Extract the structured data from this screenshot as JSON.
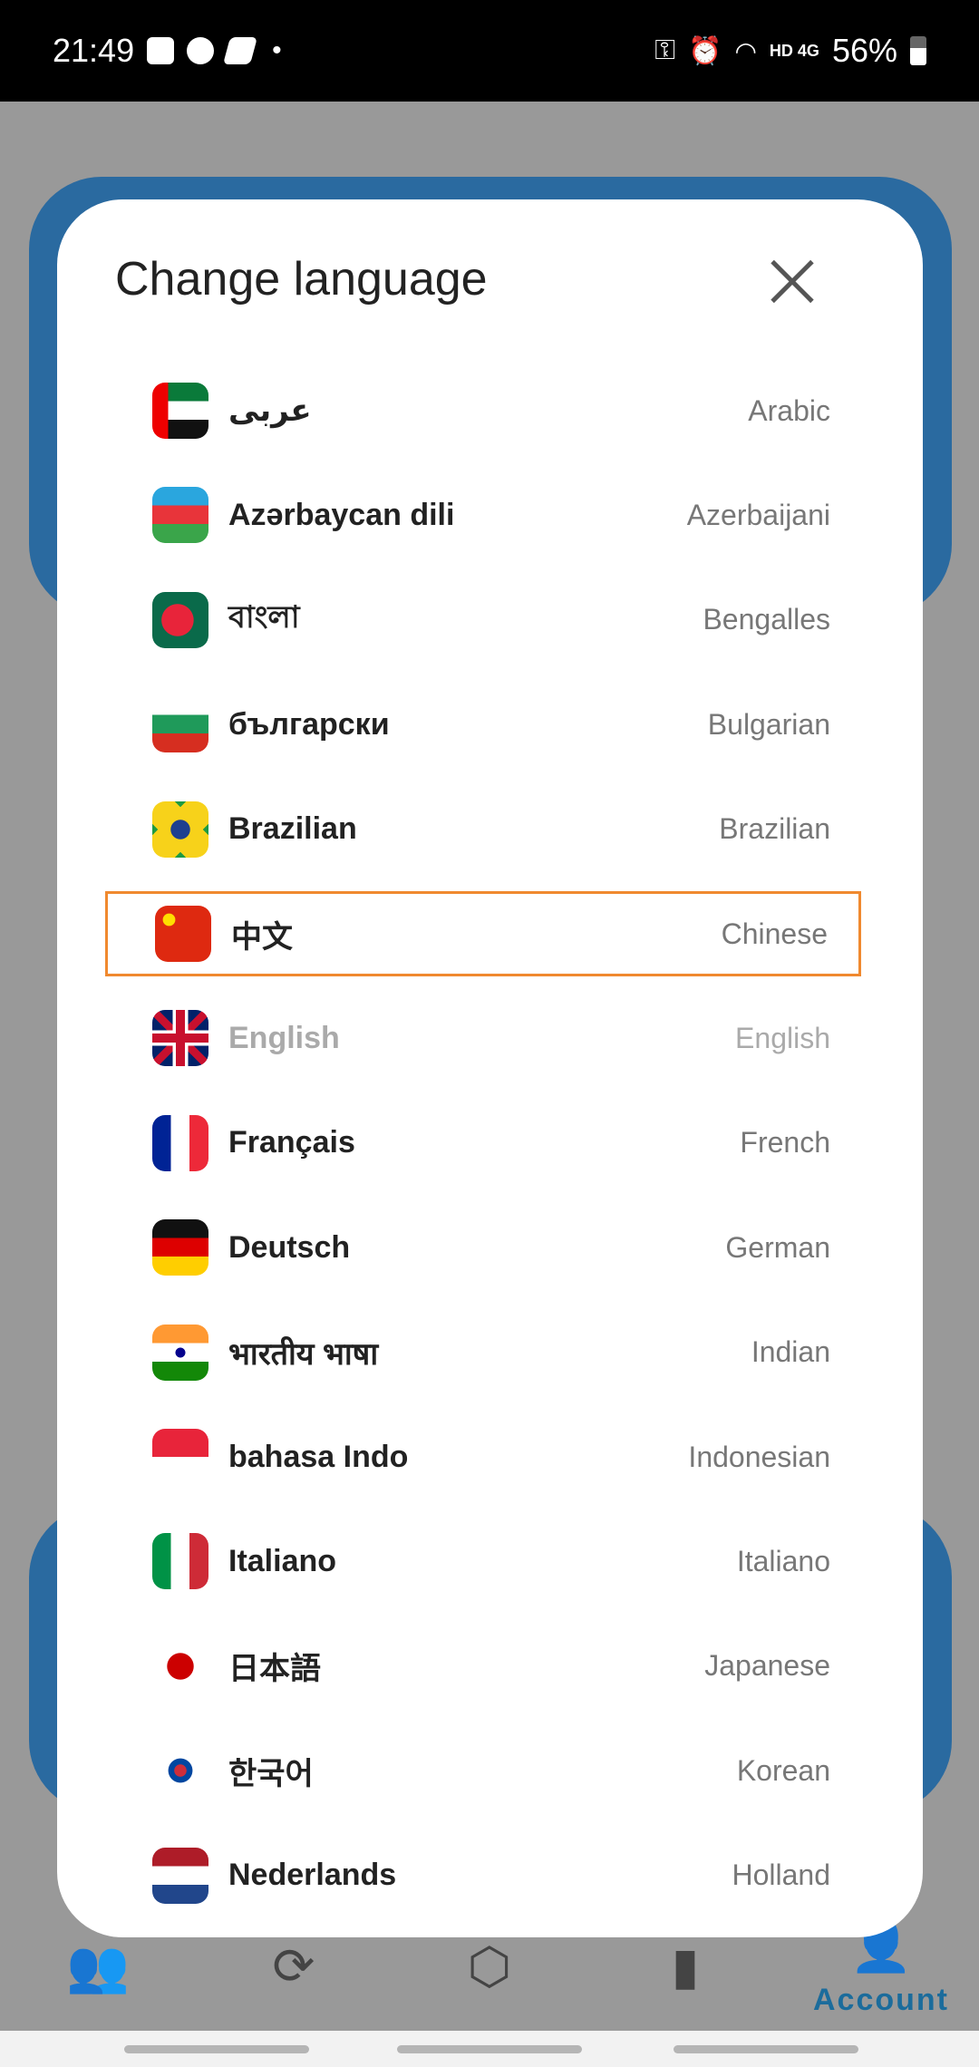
{
  "status_bar": {
    "time": "21:49",
    "network": "HD 4G",
    "battery": "56%"
  },
  "dialog": {
    "title": "Change language",
    "close_icon": "close-icon"
  },
  "languages": [
    {
      "native": "عربى",
      "english": "Arabic",
      "flag": "flag-uae-icon"
    },
    {
      "native": "Azərbaycan dili",
      "english": "Azerbaijani",
      "flag": "flag-azerbaijan-icon"
    },
    {
      "native": "বাংলা",
      "english": "Bengalles",
      "flag": "flag-bangladesh-icon"
    },
    {
      "native": "български",
      "english": "Bulgarian",
      "flag": "flag-bulgaria-icon"
    },
    {
      "native": "Brazilian",
      "english": "Brazilian",
      "flag": "flag-brazil-icon"
    },
    {
      "native": "中文",
      "english": "Chinese",
      "flag": "flag-china-icon",
      "highlighted": true
    },
    {
      "native": "English",
      "english": "English",
      "flag": "flag-uk-icon",
      "current": true
    },
    {
      "native": "Français",
      "english": "French",
      "flag": "flag-france-icon"
    },
    {
      "native": "Deutsch",
      "english": "German",
      "flag": "flag-germany-icon"
    },
    {
      "native": "भारतीय भाषा",
      "english": "Indian",
      "flag": "flag-india-icon"
    },
    {
      "native": "bahasa Indo",
      "english": "Indonesian",
      "flag": "flag-indonesia-icon"
    },
    {
      "native": "Italiano",
      "english": "Italiano",
      "flag": "flag-italy-icon"
    },
    {
      "native": "日本語",
      "english": "Japanese",
      "flag": "flag-japan-icon"
    },
    {
      "native": "한국어",
      "english": "Korean",
      "flag": "flag-korea-icon"
    },
    {
      "native": "Nederlands",
      "english": "Holland",
      "flag": "flag-netherlands-icon"
    }
  ],
  "bottom_nav": [
    {
      "icon": "users-icon"
    },
    {
      "icon": "swap-icon"
    },
    {
      "icon": "hexagon-icon"
    },
    {
      "icon": "wallet-icon"
    },
    {
      "icon": "account-icon",
      "label": "Account",
      "active": true
    }
  ],
  "colors": {
    "highlight": "#f0892f",
    "accent": "#1b6c9c"
  }
}
